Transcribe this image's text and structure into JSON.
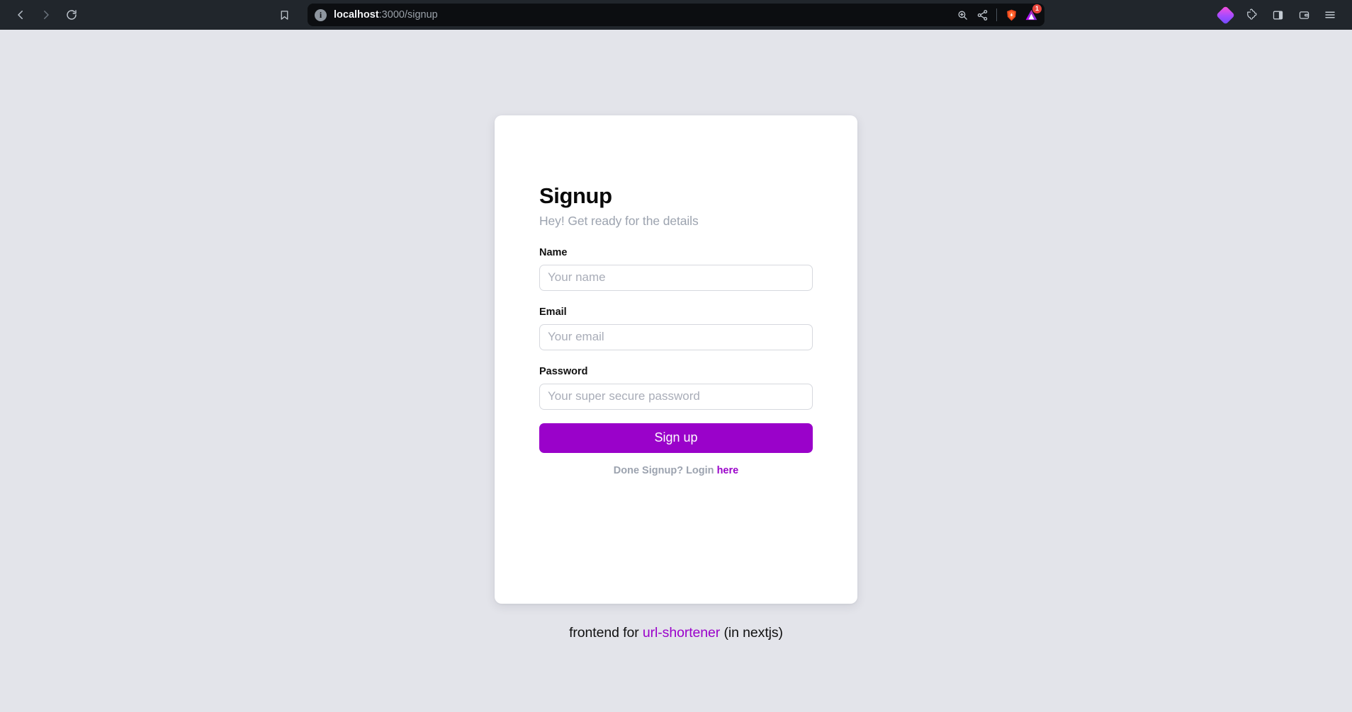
{
  "browser": {
    "nav": {
      "back": "back-navigation",
      "forward": "forward-navigation",
      "reload": "reload-page"
    },
    "bookmark_label": "Bookmark this page",
    "url": {
      "host": "localhost",
      "rest": ":3000/signup",
      "full": "localhost:3000/signup",
      "site_info_glyph": "i"
    },
    "urlbar_actions": {
      "zoom_label": "Zoom",
      "share_label": "Share",
      "shields_label": "Brave Shields",
      "extension_label": "Vercel",
      "extension_badge": "1"
    },
    "right_actions": {
      "leo_label": "Leo AI",
      "extensions_label": "Extensions",
      "sidebar_label": "Sidebar",
      "wallet_label": "Brave Wallet",
      "menu_label": "Customize and control Brave"
    },
    "colors": {
      "toolbar_bg": "#21262c",
      "urlbar_bg": "#0c0e11",
      "badge_red": "#e8453c"
    }
  },
  "page": {
    "background": "#e3e4ea",
    "accent": "#9a02ca",
    "card": {
      "title": "Signup",
      "subtitle": "Hey! Get ready for the details",
      "fields": [
        {
          "label": "Name",
          "placeholder": "Your name",
          "value": "",
          "type": "text"
        },
        {
          "label": "Email",
          "placeholder": "Your email",
          "value": "",
          "type": "text"
        },
        {
          "label": "Password",
          "placeholder": "Your super secure password",
          "value": "",
          "type": "password"
        }
      ],
      "submit_label": "Sign up",
      "login_prompt": "Done Signup? Login ",
      "login_link": "here"
    },
    "footer": {
      "prefix": "frontend for ",
      "link": "url-shortener",
      "suffix": " (in nextjs)"
    }
  }
}
